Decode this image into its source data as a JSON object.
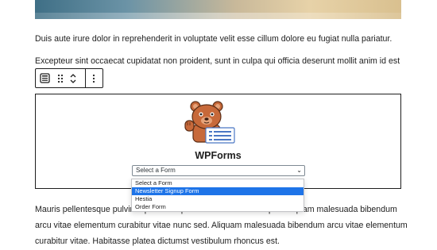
{
  "paragraphs": {
    "p1": "Duis aute irure dolor in reprehenderit in voluptate velit esse cillum dolore eu fugiat nulla pariatur.",
    "p2": "Excepteur sint occaecat cupidatat non proident, sunt in culpa qui officia deserunt mollit anim id est",
    "p3": "Mauris pellentesque pulvinar pellentesque habitant morbi tristique. Aliquam malesuada bibendum arcu vitae elementum curabitur vitae nunc sed. Aliquam malesuada bibendum arcu vitae elementum curabitur vitae. Habitasse platea dictumst vestibulum rhoncus est."
  },
  "toolbar": {
    "block_icon": "wpforms-block-icon",
    "drag_icon": "drag-handle-icon",
    "move_icon": "move-up-down-icon",
    "more_icon": "more-options-icon"
  },
  "form_block": {
    "title": "WPForms",
    "logo_icon": "wpforms-bear-mascot",
    "select_value": "Select a Form",
    "options": [
      "Select a Form",
      "Newsletter Signup Form",
      "Hestia",
      "Order Form"
    ],
    "highlighted_option": "Newsletter Signup Form"
  },
  "colors": {
    "highlight": "#1e74e8",
    "bear_brown": "#c7693a",
    "border": "#1e1e1e"
  }
}
